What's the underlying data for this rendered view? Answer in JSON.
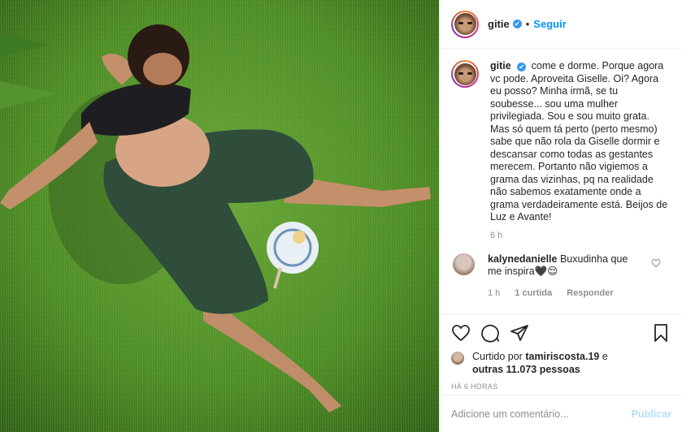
{
  "post": {
    "username": "gitie",
    "follow_label": "Seguir",
    "dot": "•",
    "verified_icon": "✔"
  },
  "caption": {
    "username": "gitie",
    "text": "come e dorme. Porque agora vc pode. Aproveita Giselle. Oi? Agora eu posso? Minha irmã, se tu soubesse... sou uma mulher privilegiada. Sou e sou muito grata. Mas só quem tá perto (perto mesmo) sabe que não rola da Giselle dormir e descansar como todas as gestantes merecem. Portanto não vigiemos a grama das vizinhas, pq na realidade não sabemos exatamente onde a grama verdadeiramente está. Beijos de Luz e Avante!",
    "time": "6 h"
  },
  "comment": {
    "username": "kalynedanielle",
    "text": "Buxudinha que me inspira🖤😌",
    "time": "1 h",
    "likes": "1 curtida",
    "reply": "Responder"
  },
  "actions": {
    "liked_by_prefix": "Curtido por",
    "liked_by_user": "tamiriscosta.19",
    "liked_by_middle": "e",
    "liked_by_others": "outras 11.073 pessoas",
    "ago": "HÁ 6 HORAS"
  },
  "composer": {
    "placeholder": "Adicione um comentário...",
    "publish_label": "Publicar"
  },
  "colors": {
    "link": "#0095f6",
    "verified": "#3897f0",
    "muted": "#8e8e8e",
    "publish_disabled": "#b2dffc"
  },
  "icons": [
    "heart-icon",
    "comment-icon",
    "share-icon",
    "bookmark-icon",
    "verified-badge-icon"
  ]
}
